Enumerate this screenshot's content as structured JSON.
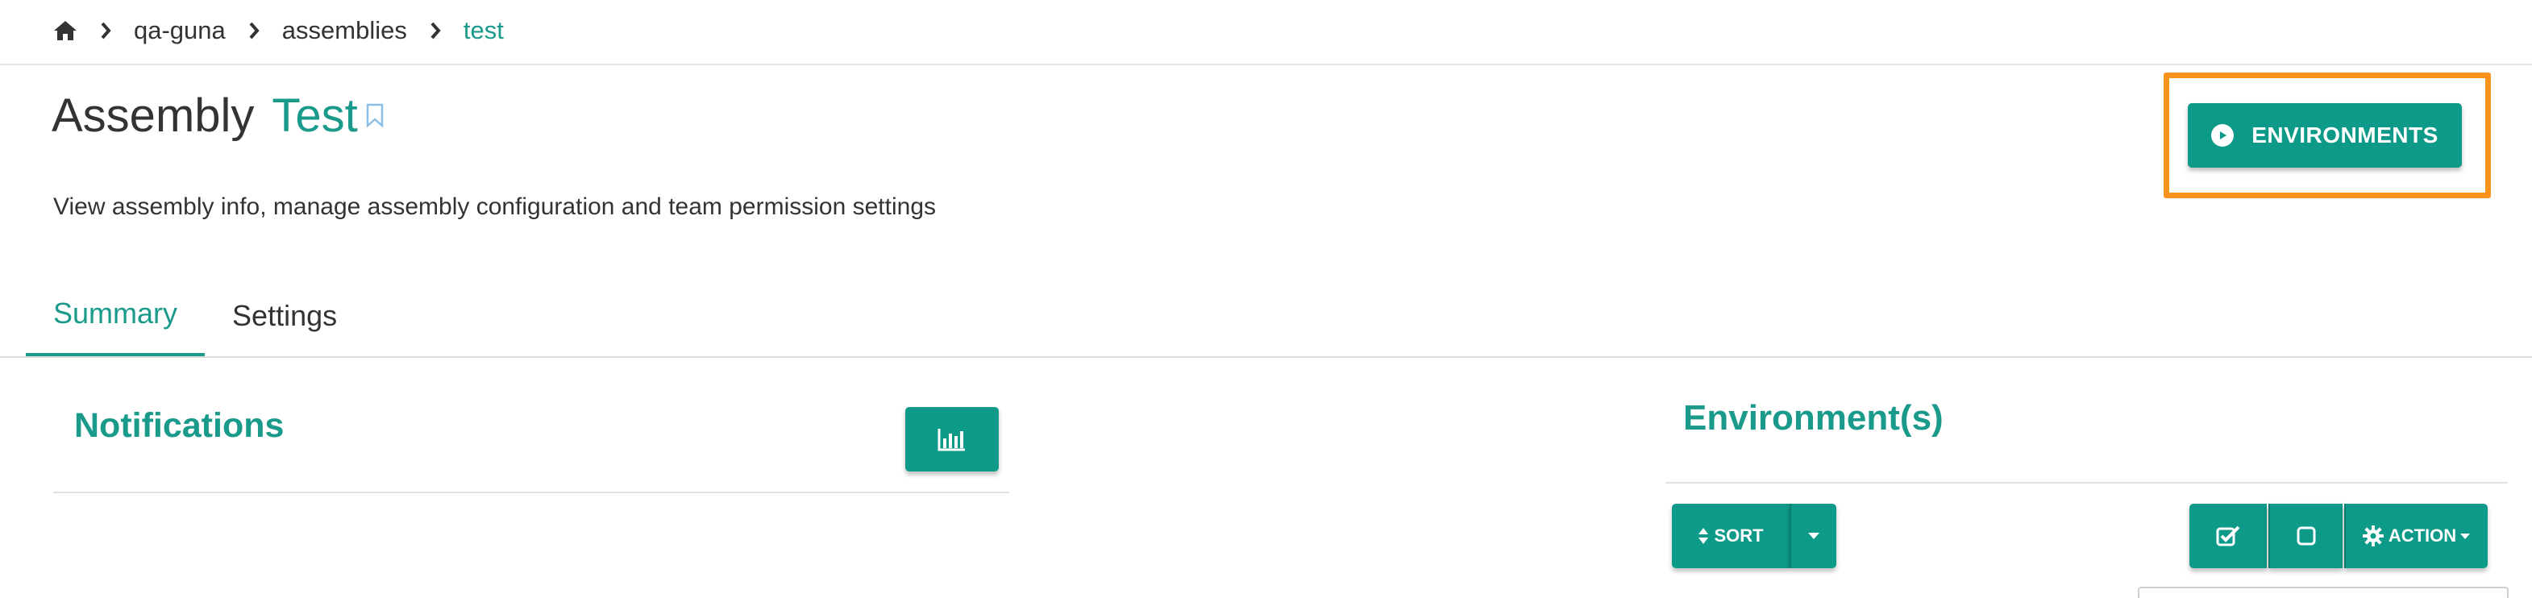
{
  "breadcrumb": {
    "items": [
      "qa-guna",
      "assemblies",
      "test"
    ]
  },
  "header": {
    "title_prefix": "Assembly",
    "assembly_name": "Test",
    "subtitle": "View assembly info, manage assembly configuration and team permission settings",
    "environments_button": "ENVIRONMENTS"
  },
  "tabs": [
    {
      "label": "Summary",
      "active": true
    },
    {
      "label": "Settings",
      "active": false
    }
  ],
  "notifications": {
    "title": "Notifications"
  },
  "environments_panel": {
    "title": "Environment(s)",
    "sort_label": "SORT",
    "action_label": "ACTION"
  },
  "icons": {
    "home": "home-icon",
    "chevron": "chevron-right-icon",
    "bookmark": "bookmark-outline-icon",
    "play": "play-circle-icon",
    "chart": "bar-chart-icon",
    "sort": "sort-icon",
    "caret": "caret-down-icon",
    "check": "checkbox-checked-icon",
    "square": "checkbox-empty-icon",
    "gear": "gear-icon"
  },
  "colors": {
    "accent": "#1a9a8a",
    "button": "#0e9a88",
    "highlight": "#f7941d"
  }
}
